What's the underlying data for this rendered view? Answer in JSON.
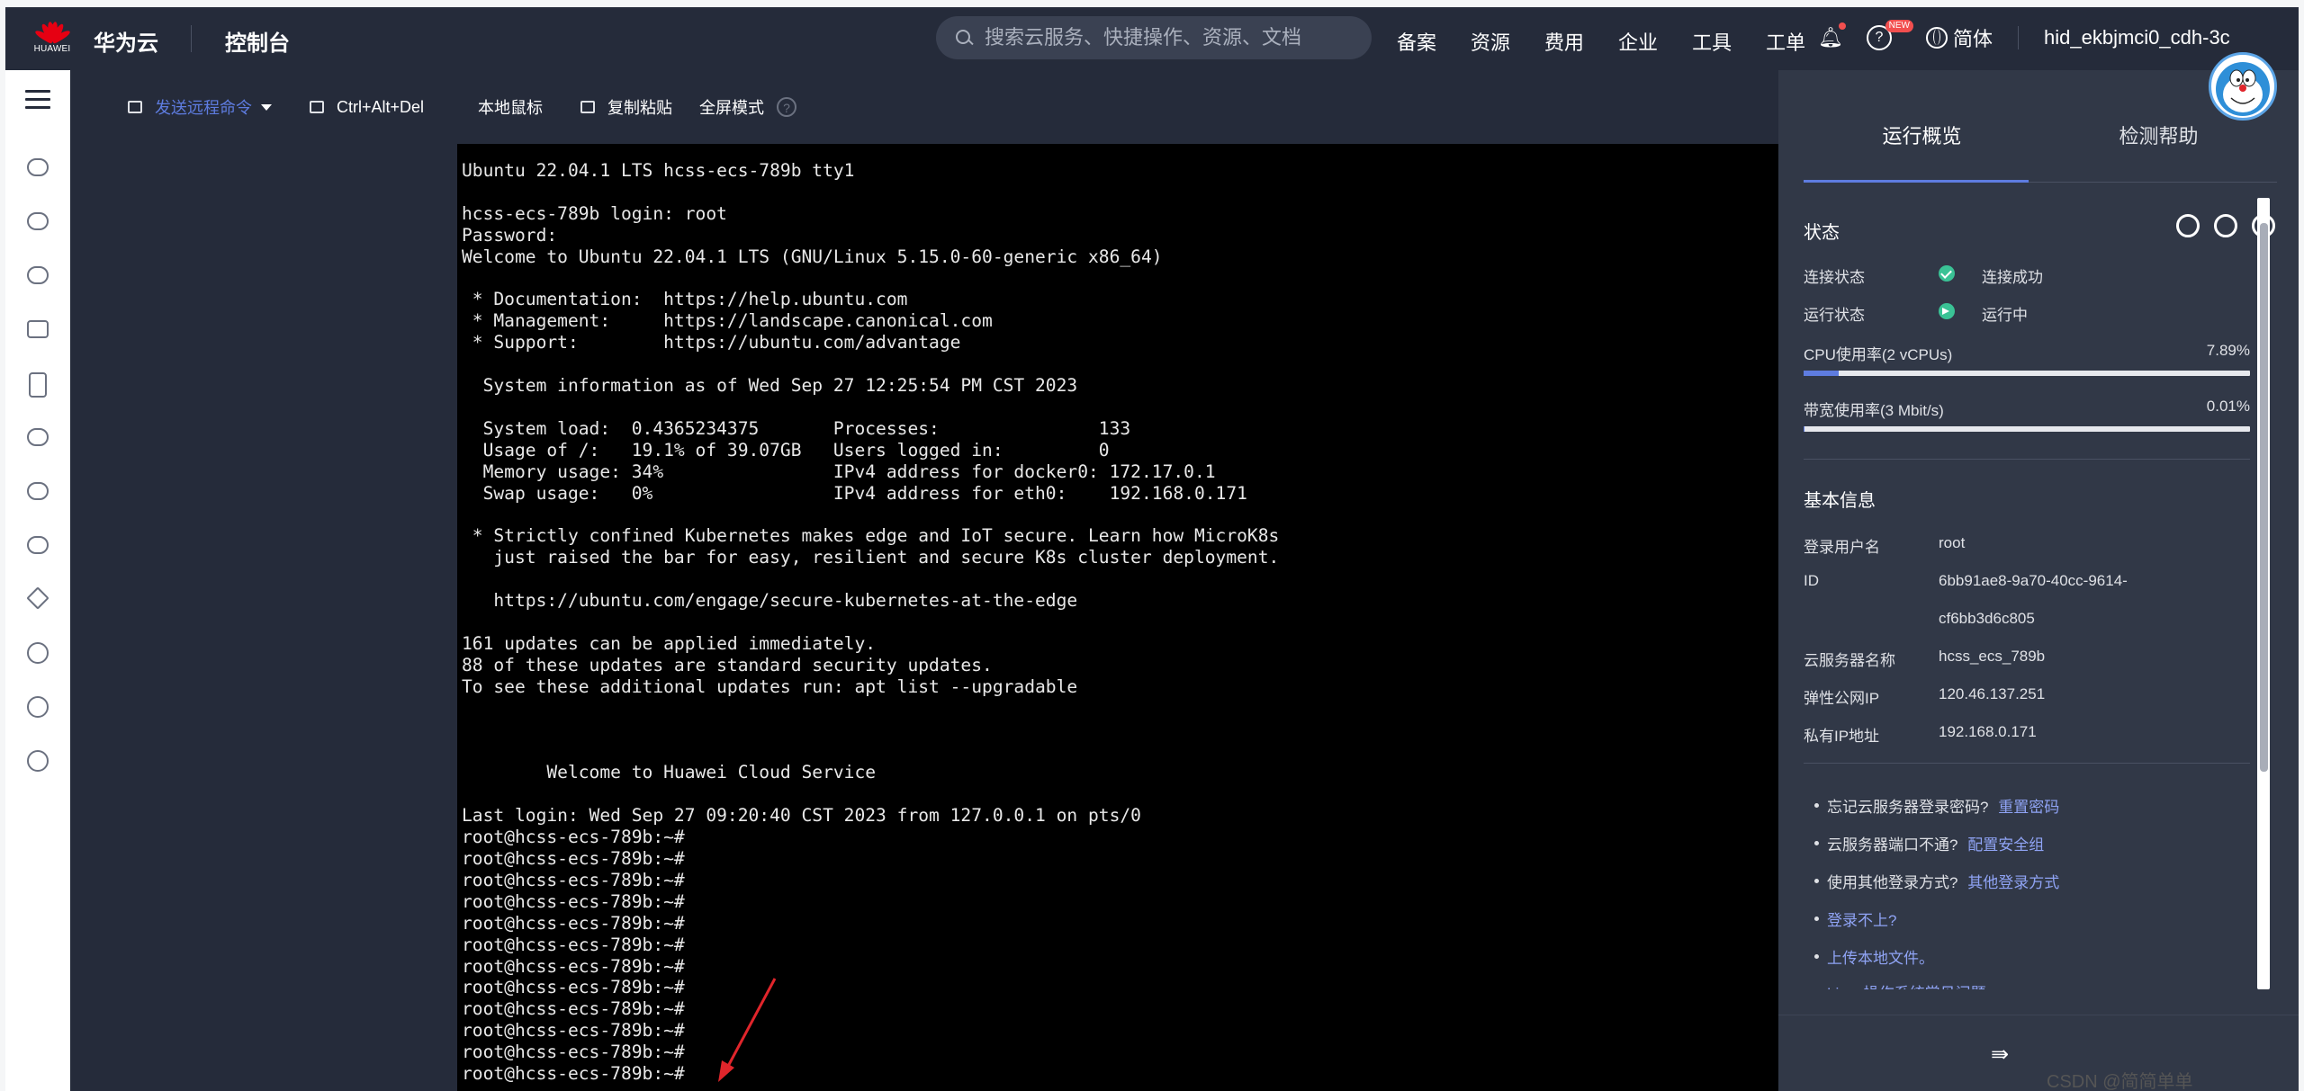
{
  "topbar": {
    "logo_text": "HUAWEI",
    "brand": "华为云",
    "console": "控制台",
    "search_placeholder": "搜索云服务、快捷操作、资源、文档",
    "nav": [
      "备案",
      "资源",
      "费用",
      "企业",
      "工具",
      "工单"
    ],
    "new_badge": "NEW",
    "language": "简体",
    "username": "hid_ekbjmci0_cdh-3c"
  },
  "toolbar": {
    "send_command": "发送远程命令",
    "ctrl_alt_del": "Ctrl+Alt+Del",
    "local_mouse": "本地鼠标",
    "copy_paste": "复制粘贴",
    "fullscreen": "全屏模式",
    "help": "?"
  },
  "terminal": {
    "lines": [
      "Ubuntu 22.04.1 LTS hcss-ecs-789b tty1",
      "",
      "hcss-ecs-789b login: root",
      "Password:",
      "Welcome to Ubuntu 22.04.1 LTS (GNU/Linux 5.15.0-60-generic x86_64)",
      "",
      " * Documentation:  https://help.ubuntu.com",
      " * Management:     https://landscape.canonical.com",
      " * Support:        https://ubuntu.com/advantage",
      "",
      "  System information as of Wed Sep 27 12:25:54 PM CST 2023",
      "",
      "  System load:  0.4365234375       Processes:               133",
      "  Usage of /:   19.1% of 39.07GB   Users logged in:         0",
      "  Memory usage: 34%                IPv4 address for docker0: 172.17.0.1",
      "  Swap usage:   0%                 IPv4 address for eth0:    192.168.0.171",
      "",
      " * Strictly confined Kubernetes makes edge and IoT secure. Learn how MicroK8s",
      "   just raised the bar for easy, resilient and secure K8s cluster deployment.",
      "",
      "   https://ubuntu.com/engage/secure-kubernetes-at-the-edge",
      "",
      "161 updates can be applied immediately.",
      "88 of these updates are standard security updates.",
      "To see these additional updates run: apt list --upgradable",
      "",
      "",
      "",
      "        Welcome to Huawei Cloud Service",
      "",
      "Last login: Wed Sep 27 09:20:40 CST 2023 from 127.0.0.1 on pts/0",
      "root@hcss-ecs-789b:~#",
      "root@hcss-ecs-789b:~#",
      "root@hcss-ecs-789b:~#",
      "root@hcss-ecs-789b:~#",
      "root@hcss-ecs-789b:~#",
      "root@hcss-ecs-789b:~#",
      "root@hcss-ecs-789b:~#",
      "root@hcss-ecs-789b:~#",
      "root@hcss-ecs-789b:~#",
      "root@hcss-ecs-789b:~#",
      "root@hcss-ecs-789b:~#",
      "root@hcss-ecs-789b:~#"
    ]
  },
  "panel": {
    "tabs": [
      "运行概览",
      "检测帮助"
    ],
    "status_title": "状态",
    "conn_label": "连接状态",
    "conn_value": "连接成功",
    "run_label": "运行状态",
    "run_value": "运行中",
    "cpu_label": "CPU使用率(2 vCPUs)",
    "cpu_value": "7.89%",
    "cpu_fraction": 0.0789,
    "bw_label": "带宽使用率(3 Mbit/s)",
    "bw_value": "0.01%",
    "bw_fraction": 0.0001,
    "basic_title": "基本信息",
    "login_user_label": "登录用户名",
    "login_user": "root",
    "id_label": "ID",
    "id_line1": "6bb91ae8-9a70-40cc-9614-",
    "id_line2": "cf6bb3d6c805",
    "server_name_label": "云服务器名称",
    "server_name": "hcss_ecs_789b",
    "public_ip_label": "弹性公网IP",
    "public_ip": "120.46.137.251",
    "private_ip_label": "私有IP地址",
    "private_ip": "192.168.0.171",
    "help_items": [
      {
        "text": "忘记云服务器登录密码?",
        "link": "重置密码"
      },
      {
        "text": "云服务器端口不通?",
        "link": "配置安全组"
      },
      {
        "text": "使用其他登录方式?",
        "link": "其他登录方式"
      },
      {
        "text": "",
        "link": "登录不上?"
      },
      {
        "text": "",
        "link": "上传本地文件。"
      }
    ],
    "cut_off_text": "Linux操作系统常见问题"
  },
  "watermark": "CSDN @简简单单OnlineZuozuo",
  "colors": {
    "accent": "#5e7ce0",
    "success": "#3ac295",
    "header": "#252b3a"
  }
}
